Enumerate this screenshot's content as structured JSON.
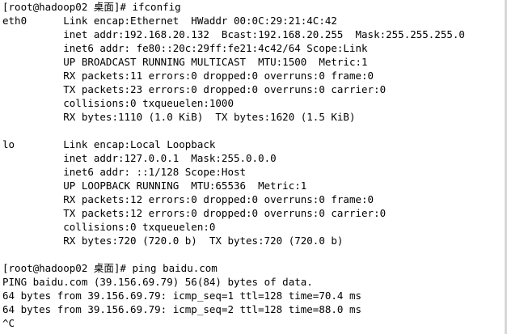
{
  "terminal": {
    "lines": [
      "[root@hadoop02 桌面]# ifconfig",
      "eth0      Link encap:Ethernet  HWaddr 00:0C:29:21:4C:42",
      "          inet addr:192.168.20.132  Bcast:192.168.20.255  Mask:255.255.255.0",
      "          inet6 addr: fe80::20c:29ff:fe21:4c42/64 Scope:Link",
      "          UP BROADCAST RUNNING MULTICAST  MTU:1500  Metric:1",
      "          RX packets:11 errors:0 dropped:0 overruns:0 frame:0",
      "          TX packets:23 errors:0 dropped:0 overruns:0 carrier:0",
      "          collisions:0 txqueuelen:1000",
      "          RX bytes:1110 (1.0 KiB)  TX bytes:1620 (1.5 KiB)",
      "",
      "lo        Link encap:Local Loopback",
      "          inet addr:127.0.0.1  Mask:255.0.0.0",
      "          inet6 addr: ::1/128 Scope:Host",
      "          UP LOOPBACK RUNNING  MTU:65536  Metric:1",
      "          RX packets:12 errors:0 dropped:0 overruns:0 frame:0",
      "          TX packets:12 errors:0 dropped:0 overruns:0 carrier:0",
      "          collisions:0 txqueuelen:0",
      "          RX bytes:720 (720.0 b)  TX bytes:720 (720.0 b)",
      "",
      "[root@hadoop02 桌面]# ping baidu.com",
      "PING baidu.com (39.156.69.79) 56(84) bytes of data.",
      "64 bytes from 39.156.69.79: icmp_seq=1 ttl=128 time=70.4 ms",
      "64 bytes from 39.156.69.79: icmp_seq=2 ttl=128 time=88.0 ms",
      "^C"
    ]
  }
}
